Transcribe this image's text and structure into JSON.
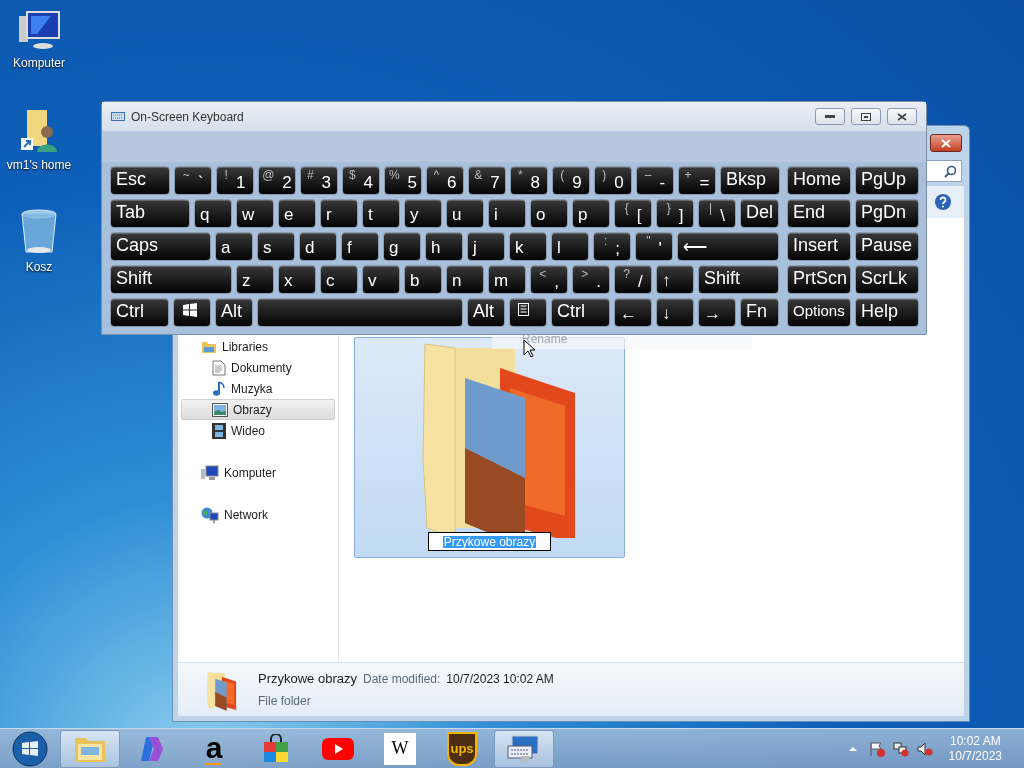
{
  "desktop_icons": [
    {
      "kind": "computer",
      "label": "Komputer"
    },
    {
      "kind": "home",
      "label": "vm1's home"
    },
    {
      "kind": "bin",
      "label": "Kosz"
    }
  ],
  "explorer": {
    "nav": [
      {
        "kind": "libraries",
        "label": "Libraries",
        "selected": false,
        "children": [
          {
            "kind": "docs",
            "label": "Dokumenty",
            "selected": false
          },
          {
            "kind": "music",
            "label": "Muzyka",
            "selected": false
          },
          {
            "kind": "pictures",
            "label": "Obrazy",
            "selected": true
          },
          {
            "kind": "video",
            "label": "Wideo",
            "selected": false
          }
        ]
      },
      {
        "kind": "computer",
        "label": "Komputer",
        "selected": false
      },
      {
        "kind": "network",
        "label": "Network",
        "selected": false
      }
    ],
    "item": {
      "name": "Przykowe obrazy",
      "selected": true,
      "renaming": true
    },
    "menu_item": "Rename",
    "details": {
      "name": "Przykowe obrazy",
      "date_label": "Date modified:",
      "date": "10/7/2023 10:02 AM",
      "type": "File folder"
    }
  },
  "keyboard": {
    "title": "On-Screen Keyboard",
    "key_rows": [
      {
        "keys": [
          {
            "label": "Esc"
          },
          {
            "label": "`",
            "shift": "~"
          },
          {
            "label": "1",
            "shift": "!"
          },
          {
            "label": "2",
            "shift": "@"
          },
          {
            "label": "3",
            "shift": "#"
          },
          {
            "label": "4",
            "shift": "$"
          },
          {
            "label": "5",
            "shift": "%"
          },
          {
            "label": "6",
            "shift": "^"
          },
          {
            "label": "7",
            "shift": "&"
          },
          {
            "label": "8",
            "shift": "*"
          },
          {
            "label": "9",
            "shift": "("
          },
          {
            "label": "0",
            "shift": ")"
          },
          {
            "label": "-",
            "shift": "–"
          },
          {
            "label": "=",
            "shift": "+"
          },
          {
            "label": "Bksp"
          }
        ]
      },
      {
        "keys": [
          {
            "label": "Tab"
          },
          {
            "label": "q"
          },
          {
            "label": "w"
          },
          {
            "label": "e"
          },
          {
            "label": "r"
          },
          {
            "label": "t"
          },
          {
            "label": "y"
          },
          {
            "label": "u"
          },
          {
            "label": "i"
          },
          {
            "label": "o"
          },
          {
            "label": "p"
          },
          {
            "label": "[",
            "shift": "{"
          },
          {
            "label": "]",
            "shift": "}"
          },
          {
            "label": "\\",
            "shift": "|"
          },
          {
            "label": "Del"
          }
        ]
      },
      {
        "keys": [
          {
            "label": "Caps"
          },
          {
            "label": "a"
          },
          {
            "label": "s"
          },
          {
            "label": "d"
          },
          {
            "label": "f"
          },
          {
            "label": "g"
          },
          {
            "label": "h"
          },
          {
            "label": "j"
          },
          {
            "label": "k"
          },
          {
            "label": "l"
          },
          {
            "label": ";",
            "shift": ":"
          },
          {
            "label": "'",
            "shift": "\""
          },
          {
            "label": "⟵"
          }
        ]
      },
      {
        "keys": [
          {
            "label": "Shift"
          },
          {
            "label": "z"
          },
          {
            "label": "x"
          },
          {
            "label": "c"
          },
          {
            "label": "v"
          },
          {
            "label": "b"
          },
          {
            "label": "n"
          },
          {
            "label": "m"
          },
          {
            "label": ",",
            "shift": "<"
          },
          {
            "label": ".",
            "shift": ">"
          },
          {
            "label": "/",
            "shift": "?"
          },
          {
            "label": "↑"
          },
          {
            "label": "Shift"
          }
        ]
      },
      {
        "keys": [
          {
            "label": "Ctrl"
          },
          {
            "kind": "windows"
          },
          {
            "label": "Alt"
          },
          {
            "kind": "space"
          },
          {
            "label": "Alt"
          },
          {
            "kind": "menu"
          },
          {
            "label": "Ctrl"
          },
          {
            "label": "←"
          },
          {
            "label": "↓"
          },
          {
            "label": "→"
          },
          {
            "label": "Fn"
          }
        ]
      }
    ],
    "nav_keys": [
      [
        "Home",
        "PgUp"
      ],
      [
        "End",
        "PgDn"
      ],
      [
        "Insert",
        "Pause"
      ],
      [
        "PrtScn",
        "ScrLk"
      ],
      [
        "Options",
        "Help"
      ]
    ]
  },
  "taskbar": {
    "apps": [
      {
        "kind": "explorer",
        "open": true
      },
      {
        "kind": "copilot",
        "open": false
      },
      {
        "kind": "amazon",
        "text": "a",
        "open": false
      },
      {
        "kind": "store",
        "open": false
      },
      {
        "kind": "youtube",
        "open": false
      },
      {
        "kind": "wikipedia",
        "text": "W",
        "open": false
      },
      {
        "kind": "ups",
        "text": "ups",
        "open": false
      },
      {
        "kind": "keyboard",
        "open": true
      }
    ],
    "time": "10:02 AM",
    "date": "10/7/2023"
  }
}
